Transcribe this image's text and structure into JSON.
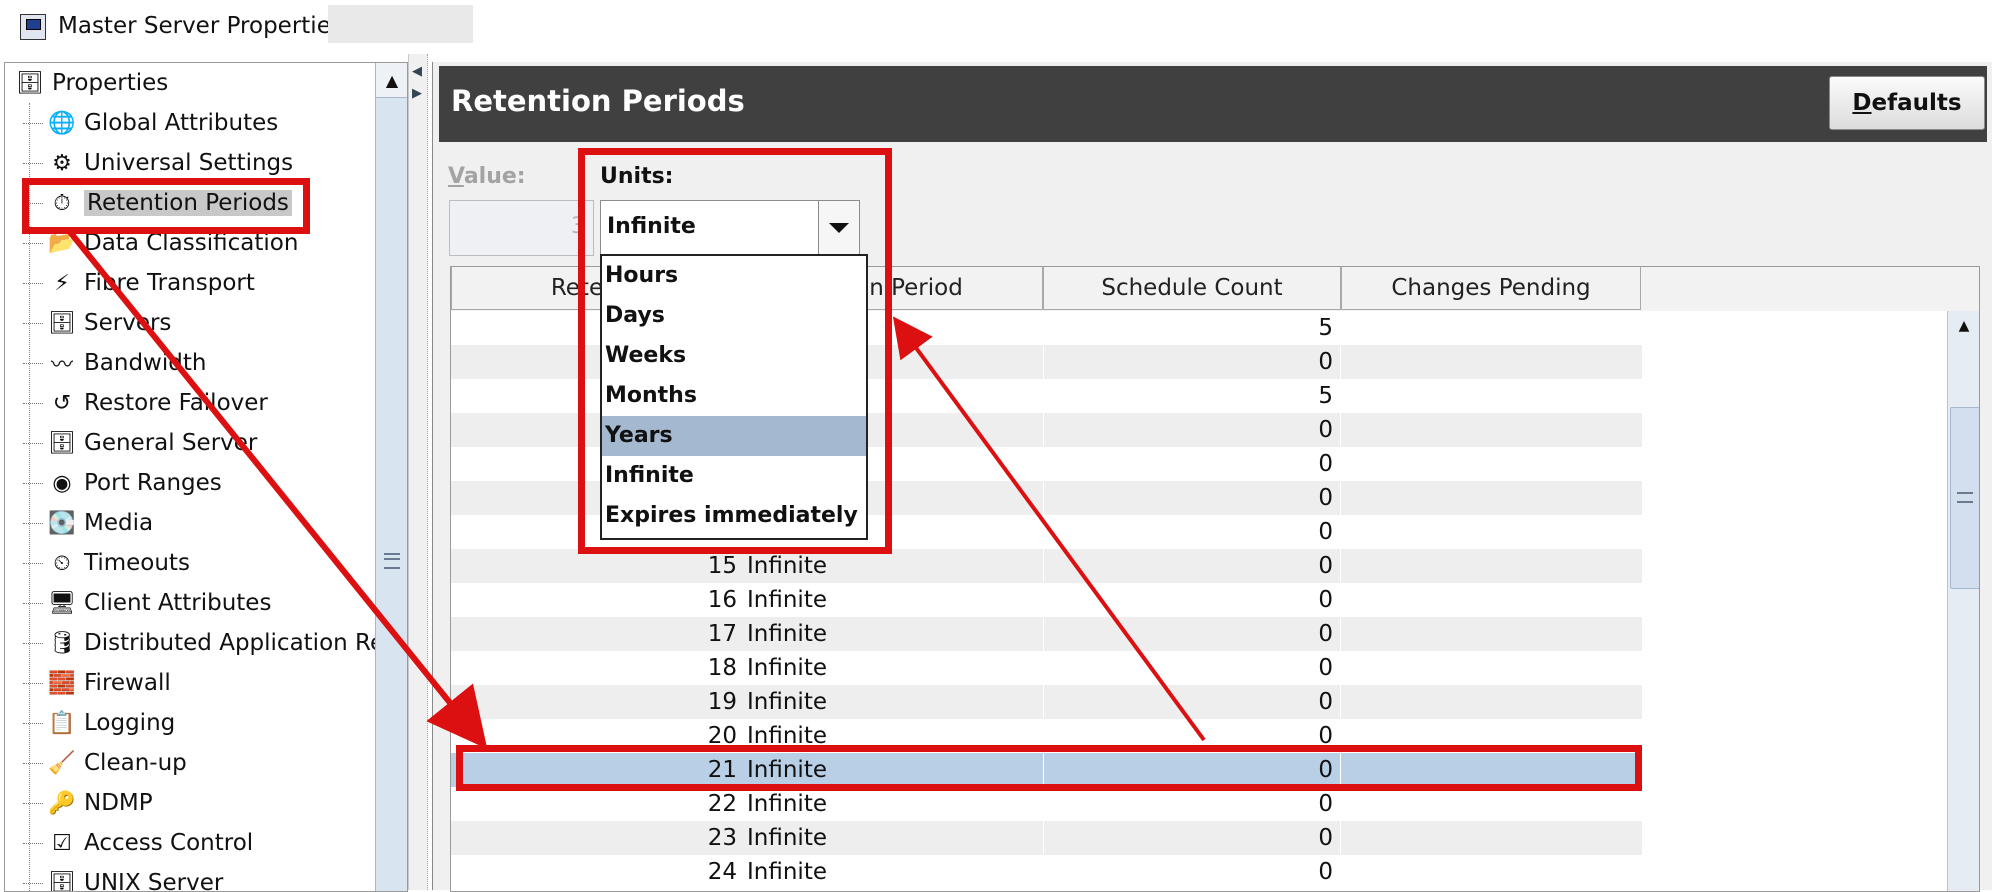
{
  "window": {
    "title": "Master Server Properties:"
  },
  "tree": {
    "root": "Properties",
    "items": [
      {
        "label": "Global Attributes",
        "icon": "globe-icon"
      },
      {
        "label": "Universal Settings",
        "icon": "settings-icon"
      },
      {
        "label": "Retention Periods",
        "icon": "retention-clock-icon",
        "selected": true
      },
      {
        "label": "Data Classification",
        "icon": "classification-icon"
      },
      {
        "label": "Fibre Transport",
        "icon": "fibre-icon"
      },
      {
        "label": "Servers",
        "icon": "server-icon"
      },
      {
        "label": "Bandwidth",
        "icon": "bandwidth-icon"
      },
      {
        "label": "Restore Failover",
        "icon": "failover-icon"
      },
      {
        "label": "General Server",
        "icon": "server-icon"
      },
      {
        "label": "Port Ranges",
        "icon": "port-icon"
      },
      {
        "label": "Media",
        "icon": "media-icon"
      },
      {
        "label": "Timeouts",
        "icon": "clock-icon"
      },
      {
        "label": "Client Attributes",
        "icon": "client-icon"
      },
      {
        "label": "Distributed Application Re",
        "icon": "database-icon"
      },
      {
        "label": "Firewall",
        "icon": "firewall-icon"
      },
      {
        "label": "Logging",
        "icon": "logging-icon"
      },
      {
        "label": "Clean-up",
        "icon": "cleanup-icon"
      },
      {
        "label": "NDMP",
        "icon": "ndmp-icon"
      },
      {
        "label": "Access Control",
        "icon": "access-icon"
      },
      {
        "label": "UNIX Server",
        "icon": "server-icon"
      }
    ]
  },
  "panel": {
    "title": "Retention Periods",
    "defaults_button": "Defaults",
    "value_label": "Value:",
    "value": "3",
    "units_label": "Units:",
    "units_selected": "Infinite"
  },
  "dropdown": {
    "options": [
      "Hours",
      "Days",
      "Weeks",
      "Months",
      "Years",
      "Infinite",
      "Expires immediately"
    ],
    "highlighted": "Years"
  },
  "table": {
    "headers": [
      "Retentio",
      "ntion Period",
      "Schedule Count",
      "Changes Pending"
    ],
    "rows": [
      {
        "level": "",
        "period": "",
        "count": "5",
        "pending": ""
      },
      {
        "level": "",
        "period": "",
        "count": "0",
        "pending": ""
      },
      {
        "level": "",
        "period": "",
        "count": "5",
        "pending": ""
      },
      {
        "level": "",
        "period": "",
        "count": "0",
        "pending": ""
      },
      {
        "level": "",
        "period": "",
        "count": "0",
        "pending": ""
      },
      {
        "level": "",
        "period": "",
        "count": "0",
        "pending": ""
      },
      {
        "level": "",
        "period": "",
        "count": "0",
        "pending": ""
      },
      {
        "level": "15",
        "period": "Infinite",
        "count": "0",
        "pending": ""
      },
      {
        "level": "16",
        "period": "Infinite",
        "count": "0",
        "pending": ""
      },
      {
        "level": "17",
        "period": "Infinite",
        "count": "0",
        "pending": ""
      },
      {
        "level": "18",
        "period": "Infinite",
        "count": "0",
        "pending": ""
      },
      {
        "level": "19",
        "period": "Infinite",
        "count": "0",
        "pending": ""
      },
      {
        "level": "20",
        "period": "Infinite",
        "count": "0",
        "pending": ""
      },
      {
        "level": "21",
        "period": "Infinite",
        "count": "0",
        "pending": "",
        "selected": true
      },
      {
        "level": "22",
        "period": "Infinite",
        "count": "0",
        "pending": ""
      },
      {
        "level": "23",
        "period": "Infinite",
        "count": "0",
        "pending": ""
      },
      {
        "level": "24",
        "period": "Infinite",
        "count": "0",
        "pending": ""
      }
    ]
  },
  "colors": {
    "annotation": "#dc1010",
    "header_bar": "#404040",
    "selected_row": "#b8cfe6",
    "dropdown_highlight": "#a4b8cf"
  }
}
